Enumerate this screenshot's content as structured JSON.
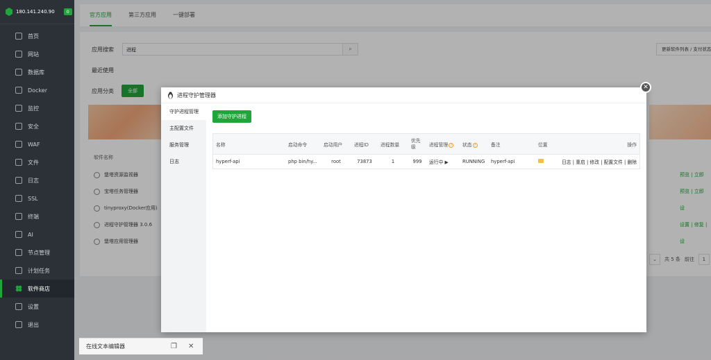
{
  "sidebar": {
    "ip": "180.141.240.90",
    "badge": "0",
    "items": [
      {
        "label": "首页",
        "icon": "home-icon"
      },
      {
        "label": "网站",
        "icon": "globe-icon"
      },
      {
        "label": "数据库",
        "icon": "database-icon"
      },
      {
        "label": "Docker",
        "icon": "docker-icon"
      },
      {
        "label": "监控",
        "icon": "monitor-icon"
      },
      {
        "label": "安全",
        "icon": "shield-icon"
      },
      {
        "label": "WAF",
        "icon": "waf-icon"
      },
      {
        "label": "文件",
        "icon": "folder-icon"
      },
      {
        "label": "日志",
        "icon": "log-icon"
      },
      {
        "label": "SSL",
        "icon": "ssl-icon"
      },
      {
        "label": "终端",
        "icon": "terminal-icon"
      },
      {
        "label": "AI",
        "icon": "ai-icon"
      },
      {
        "label": "节点管理",
        "icon": "node-icon"
      },
      {
        "label": "计划任务",
        "icon": "calendar-icon"
      },
      {
        "label": "软件商店",
        "icon": "store-icon"
      },
      {
        "label": "设置",
        "icon": "gear-icon"
      },
      {
        "label": "退出",
        "icon": "logout-icon"
      }
    ],
    "active_index": 14
  },
  "tabs": [
    "官方应用",
    "第三方应用",
    "一键部署"
  ],
  "search": {
    "label": "应用搜索",
    "value": "进程"
  },
  "update_button": "更新软件列表 / 支付状态",
  "recent_label": "最近使用",
  "category": {
    "label": "应用分类",
    "all": "全部"
  },
  "software_header": "软件名称",
  "software_list": [
    "堡塔资源监视器",
    "宝塔任务管理器",
    "tinyproxy(Docker应用)",
    "进程守护管理器 3.0.6",
    "堡塔应用管理器"
  ],
  "right_links": [
    "预览 | 立即",
    "预览 | 立即",
    "设",
    "设置 | 修复 |",
    "设"
  ],
  "pager": {
    "total": "共 5 条",
    "goto": "前往",
    "page": "1"
  },
  "modal": {
    "title": "进程守护管理器",
    "nav": [
      "守护进程管理",
      "主配置文件",
      "服务管理",
      "日志"
    ],
    "add_button": "添加守护进程",
    "columns": [
      "名称",
      "启动命令",
      "启动用户",
      "进程ID",
      "进程数量",
      "优先级",
      "进程管理",
      "状态",
      "备注",
      "位置",
      "操作"
    ],
    "rows": [
      {
        "name": "hyperf-api",
        "command": "php bin/hy...",
        "user": "root",
        "pid": "73873",
        "count": "1",
        "priority": "999",
        "manage": "运行中 ▶",
        "status": "RUNNING",
        "note": "hyperf-api",
        "ops": "日志 | 重启 | 修改 | 配置文件 | 删除"
      }
    ]
  },
  "editor": {
    "title": "在线文本编辑器"
  },
  "colors": {
    "accent": "#20a53a",
    "sidebar": "#2c3138"
  }
}
